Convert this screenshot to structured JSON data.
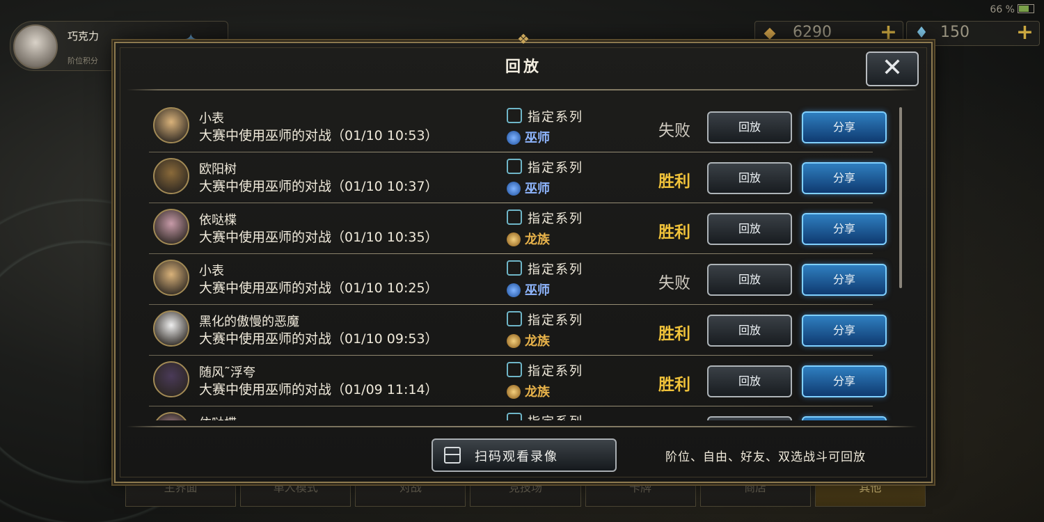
{
  "status_bar": {
    "battery": "66 %"
  },
  "player": {
    "name": "巧克力",
    "subtitle": "阶位积分"
  },
  "currencies": [
    {
      "icon": "gold-icon",
      "value": "6290",
      "plus": "+"
    },
    {
      "icon": "crystal-icon",
      "value": "150",
      "plus": "+"
    }
  ],
  "dialog": {
    "title": "回放",
    "close_label": "✕",
    "records": [
      {
        "player": "小表",
        "desc": "大赛中使用巫师的对战（01/10 10:53）",
        "mode": "指定系列",
        "class": "巫师",
        "class_type": "wiz",
        "result": "失败",
        "result_type": "lose",
        "replay": "回放",
        "share": "分享",
        "avatar_color": "#d9b27a"
      },
      {
        "player": "欧阳树",
        "desc": "大赛中使用巫师的对战（01/10 10:37）",
        "mode": "指定系列",
        "class": "巫师",
        "class_type": "wiz",
        "result": "胜利",
        "result_type": "win",
        "replay": "回放",
        "share": "分享",
        "avatar_color": "#8a6a3a"
      },
      {
        "player": "依哒楪",
        "desc": "大赛中使用巫师的对战（01/10 10:35）",
        "mode": "指定系列",
        "class": "龙族",
        "class_type": "dragon",
        "result": "胜利",
        "result_type": "win",
        "replay": "回放",
        "share": "分享",
        "avatar_color": "#c79aa8"
      },
      {
        "player": "小表",
        "desc": "大赛中使用巫师的对战（01/10 10:25）",
        "mode": "指定系列",
        "class": "巫师",
        "class_type": "wiz",
        "result": "失败",
        "result_type": "lose",
        "replay": "回放",
        "share": "分享",
        "avatar_color": "#d9b27a"
      },
      {
        "player": "黑化的傲慢的恶魔",
        "desc": "大赛中使用巫师的对战（01/10 09:53）",
        "mode": "指定系列",
        "class": "龙族",
        "class_type": "dragon",
        "result": "胜利",
        "result_type": "win",
        "replay": "回放",
        "share": "分享",
        "avatar_color": "#eeeeee"
      },
      {
        "player": "随风˜浮夸",
        "desc": "大赛中使用巫师的对战（01/09 11:14）",
        "mode": "指定系列",
        "class": "龙族",
        "class_type": "dragon",
        "result": "胜利",
        "result_type": "win",
        "replay": "回放",
        "share": "分享",
        "avatar_color": "#4a3a58"
      }
    ],
    "partial_row": {
      "player": "依哒楪",
      "mode": "指定系列"
    },
    "scan_button": "扫码观看录像",
    "note": "阶位、自由、好友、双选战斗可回放"
  },
  "bottom_nav": [
    {
      "label": "主界面",
      "active": false
    },
    {
      "label": "单人模式",
      "active": false
    },
    {
      "label": "对战",
      "active": false
    },
    {
      "label": "竞技场",
      "active": false
    },
    {
      "label": "卡牌",
      "active": false
    },
    {
      "label": "商店",
      "active": false
    },
    {
      "label": "其他",
      "active": true
    }
  ]
}
